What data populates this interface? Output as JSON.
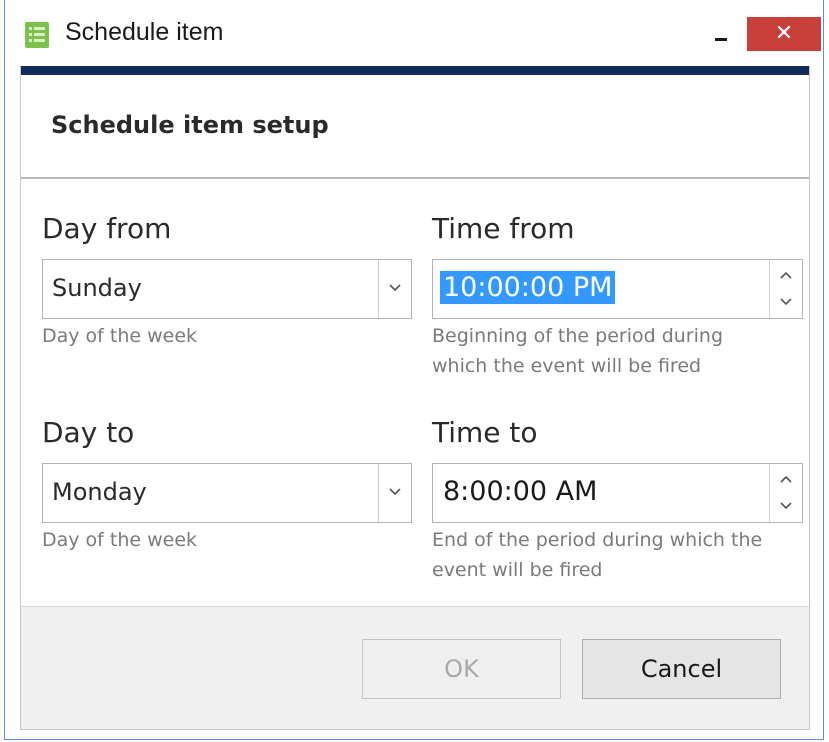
{
  "window": {
    "title": "Schedule item",
    "minimize_icon": "minimize-icon",
    "close_label": "✕",
    "accent_color": "#122c5c",
    "close_color": "#c9403a"
  },
  "header": {
    "title": "Schedule item setup"
  },
  "form": {
    "day_from": {
      "label": "Day from",
      "value": "Sunday",
      "hint": "Day of the week"
    },
    "time_from": {
      "label": "Time from",
      "value": "10:00:00 PM",
      "hint_line1": "Beginning of the period during",
      "hint_line2": "which the event will be fired"
    },
    "day_to": {
      "label": "Day to",
      "value": "Monday",
      "hint": "Day of the week"
    },
    "time_to": {
      "label": "Time to",
      "value": "8:00:00 AM",
      "hint_line1": "End of the period during which the",
      "hint_line2": "event will be fired"
    }
  },
  "footer": {
    "ok_label": "OK",
    "cancel_label": "Cancel"
  }
}
